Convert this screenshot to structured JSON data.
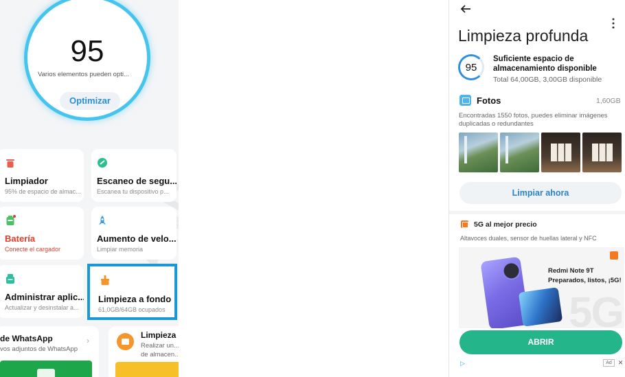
{
  "colors": {
    "accent_ring": "#45c4ee",
    "action_blue": "#2a8fd0",
    "highlight_border": "#1a98d6",
    "warning_red": "#e13c2b",
    "open_button": "#25b58a"
  },
  "left": {
    "score": "95",
    "score_desc": "Varios elementos pueden opti...",
    "optimize_label": "Optimizar",
    "cards": [
      {
        "icon": "trash-icon",
        "title": "Limpiador",
        "subtitle": "95% de espacio de almac..."
      },
      {
        "icon": "shield-scan-icon",
        "title": "Escaneo de segu...",
        "subtitle": "Escanea tu dispositivo p..."
      },
      {
        "icon": "battery-icon",
        "title": "Batería",
        "subtitle": "Conecte el cargador"
      },
      {
        "icon": "rocket-icon",
        "title": "Aumento de velo...",
        "subtitle": "Limpiar memoria"
      },
      {
        "icon": "apps-icon",
        "title": "Administrar aplic...",
        "subtitle": "Actualizar y desinstalar a..."
      },
      {
        "icon": "broom-icon",
        "title": "Limpieza a fondo",
        "subtitle": "61,0GB/64GB ocupados"
      }
    ],
    "whatsapp": {
      "title": "de WhatsApp",
      "subtitle": "vos adjuntos de WhatsApp"
    },
    "deep_clean_promo": {
      "title": "Limpieza",
      "subtitle": "Realizar un... de almacen..."
    }
  },
  "right": {
    "title": "Limpieza profunda",
    "score": "95",
    "storage_title": "Suficiente espacio de almacenamiento disponible",
    "storage_sub": "Total 64,00GB, 3,00GB disponible",
    "photos": {
      "title": "Fotos",
      "size": "1,60GB",
      "desc": "Encontradas 1550 fotos, puedes eliminar imágenes duplicadas o redundantes",
      "clean_label": "Limpiar ahora"
    },
    "ad": {
      "title": "5G al mejor precio",
      "desc": "Altavoces duales, sensor de huellas lateral y NFC",
      "model": "Redmi Note 9T",
      "tagline": "Preparados, listos, ¡5G!",
      "open_label": "ABRIR",
      "ad_tag": "Ad"
    }
  }
}
